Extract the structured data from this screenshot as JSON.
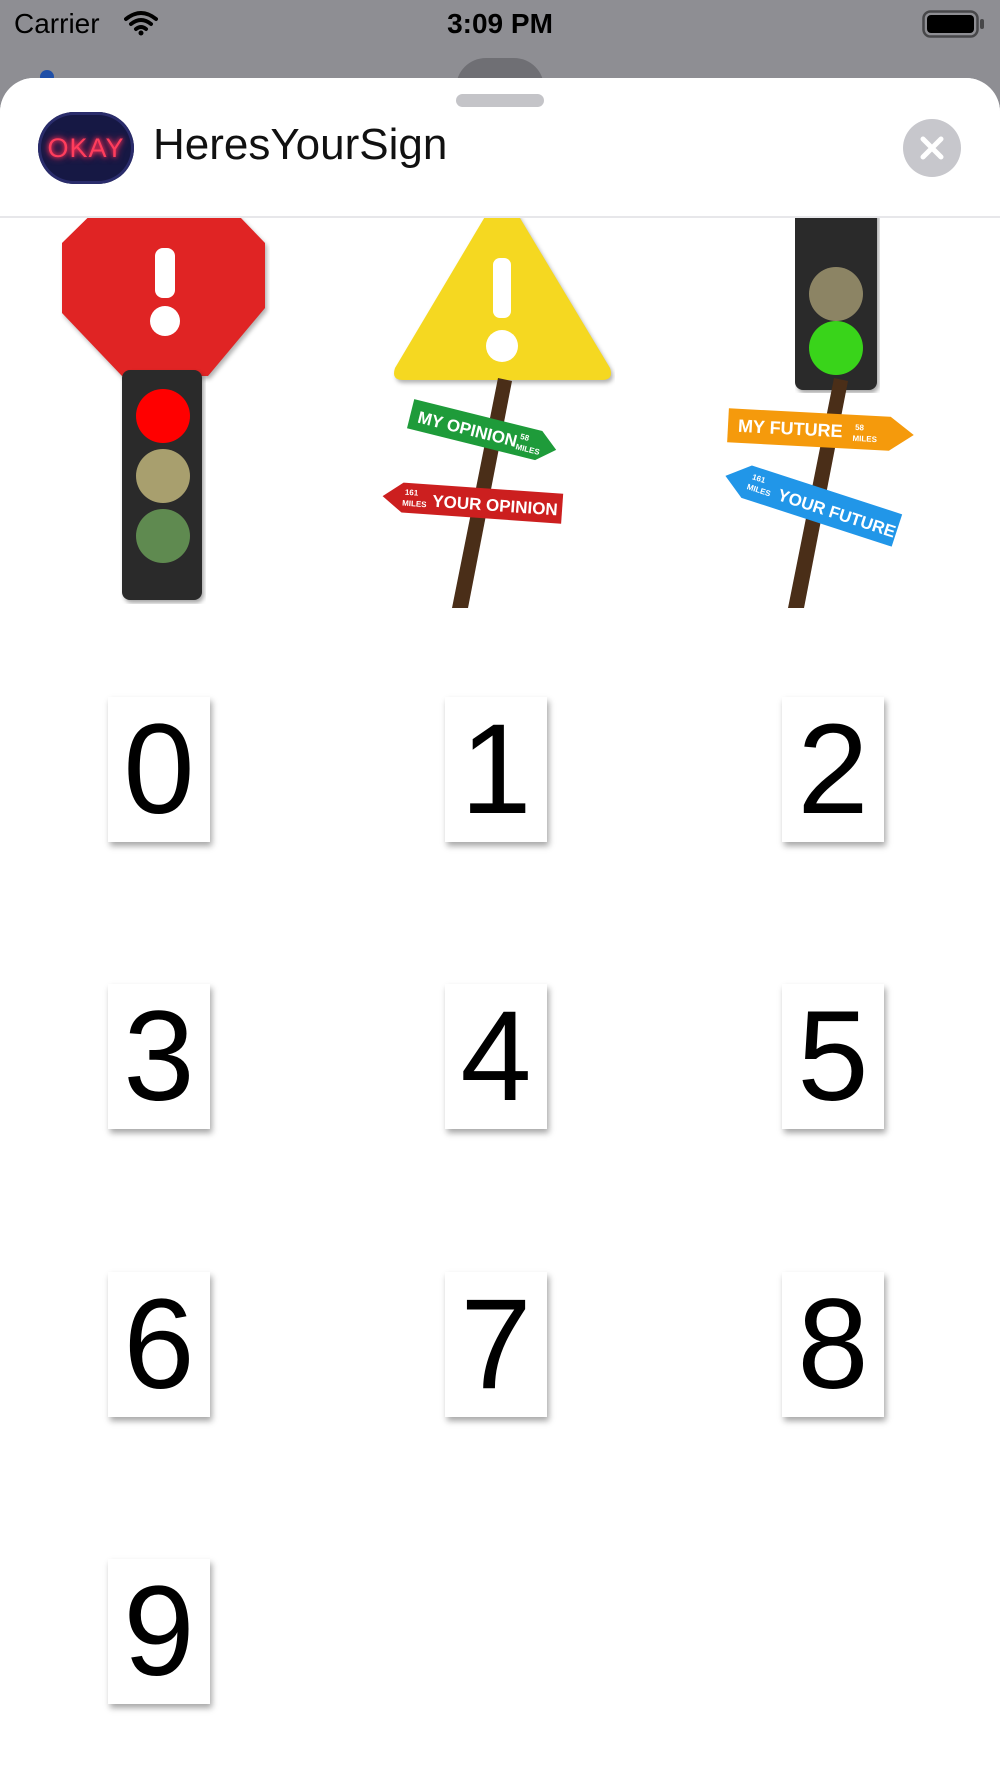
{
  "status_bar": {
    "carrier": "Carrier",
    "time": "3:09 PM"
  },
  "app": {
    "title": "HeresYourSign",
    "icon_text": "OKAY",
    "icon_name": "okay-neon-icon"
  },
  "header": {
    "close_icon": "close-icon"
  },
  "stickers": {
    "stop_sign": "stop-sign-icon",
    "warning_sign": "warning-sign-icon",
    "traffic_light_green": "traffic-light-green-icon",
    "traffic_light_red": "traffic-light-red-icon",
    "opinion_post": {
      "top_arrow": "MY OPINION",
      "top_distance_num": "58",
      "top_distance_unit": "MILES",
      "bottom_arrow": "YOUR OPINION",
      "bottom_distance_num": "161",
      "bottom_distance_unit": "MILES"
    },
    "future_post": {
      "top_arrow": "MY FUTURE",
      "top_distance_num": "58",
      "top_distance_unit": "MILES",
      "bottom_arrow": "YOUR FUTURE",
      "bottom_distance_num": "161",
      "bottom_distance_unit": "MILES"
    },
    "numbers": [
      "0",
      "1",
      "2",
      "3",
      "4",
      "5",
      "6",
      "7",
      "8",
      "9"
    ]
  },
  "colors": {
    "stop_red": "#e02424",
    "warning_yellow": "#f5d821",
    "light_green": "#39d41a",
    "light_red": "#ff0000",
    "sign_green": "#1e9b3a",
    "sign_red": "#cc1f1f",
    "sign_orange": "#f59a0c",
    "sign_blue": "#2196e8"
  }
}
